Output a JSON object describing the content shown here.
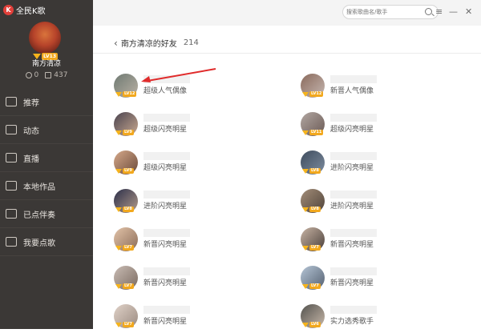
{
  "app": {
    "title": "全民K歌",
    "logo_char": "K"
  },
  "profile": {
    "username": "南方清凉",
    "level": "LV13",
    "stat_a": "0",
    "stat_b": "437"
  },
  "menu": [
    {
      "label": "推荐",
      "icon": "thumb-up-icon"
    },
    {
      "label": "动态",
      "icon": "chat-icon"
    },
    {
      "label": "直播",
      "icon": "live-icon"
    },
    {
      "label": "本地作品",
      "icon": "monitor-icon"
    },
    {
      "label": "已点伴奏",
      "icon": "music-list-icon"
    },
    {
      "label": "我要点歌",
      "icon": "bell-icon"
    }
  ],
  "search": {
    "placeholder": "搜索歌曲名/歌手"
  },
  "window_controls": {
    "menu": "≡",
    "minimize": "—",
    "close": "✕"
  },
  "page": {
    "back": "‹",
    "title": "南方清凉的好友",
    "count": "214"
  },
  "friends": [
    {
      "title": "超级人气偶像",
      "level": "LV12"
    },
    {
      "title": "新晋人气偶像",
      "level": "LV12"
    },
    {
      "title": "超级闪亮明星",
      "level": "LV9"
    },
    {
      "title": "超级闪亮明星",
      "level": "LV11"
    },
    {
      "title": "超级闪亮明星",
      "level": "LV9"
    },
    {
      "title": "进阶闪亮明星",
      "level": "LV8"
    },
    {
      "title": "进阶闪亮明星",
      "level": "LV8"
    },
    {
      "title": "进阶闪亮明星",
      "level": "LV8"
    },
    {
      "title": "新晋闪亮明星",
      "level": "LV7"
    },
    {
      "title": "新晋闪亮明星",
      "level": "LV7"
    },
    {
      "title": "新晋闪亮明星",
      "level": "LV7"
    },
    {
      "title": "新晋闪亮明星",
      "level": "LV7"
    },
    {
      "title": "新晋闪亮明星",
      "level": "LV7"
    },
    {
      "title": "实力选秀歌手",
      "level": "LV6"
    }
  ]
}
